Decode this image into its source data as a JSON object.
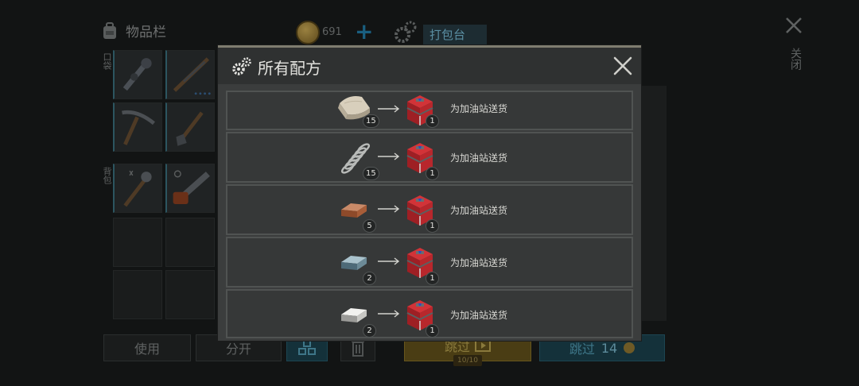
{
  "inventory": {
    "title": "物品栏",
    "coins": "691",
    "pack_tab": "打包台",
    "side_labels": [
      "口袋",
      "背包"
    ]
  },
  "close": {
    "label": "关闭"
  },
  "buttons": {
    "use": "使用",
    "split": "分开",
    "skip": "跳过",
    "skip_count": "10/10",
    "skip_cost_label": "跳过",
    "skip_cost": "14"
  },
  "modal": {
    "title": "所有配方",
    "recipes": [
      {
        "ingredient": "cloth-icon",
        "ingredient_count": "15",
        "output": "red-toolbox-icon",
        "output_count": "1",
        "label": "为加油站送货"
      },
      {
        "ingredient": "spring-icon",
        "ingredient_count": "15",
        "output": "red-toolbox-icon",
        "output_count": "1",
        "label": "为加油站送货"
      },
      {
        "ingredient": "copper-ingot-icon",
        "ingredient_count": "5",
        "output": "red-toolbox-icon",
        "output_count": "1",
        "label": "为加油站送货"
      },
      {
        "ingredient": "steel-ingot-icon",
        "ingredient_count": "2",
        "output": "red-toolbox-icon",
        "output_count": "1",
        "label": "为加油站送货"
      },
      {
        "ingredient": "silver-ingot-icon",
        "ingredient_count": "2",
        "output": "red-toolbox-icon",
        "output_count": "1",
        "label": "为加油站送货"
      }
    ]
  },
  "colors": {
    "modal_bg": "#3b3d3d",
    "modal_header": "#2f3131",
    "accent_teal": "#14313a",
    "accent_gold": "#4a3d14",
    "toolbox_red": "#b3262a"
  }
}
